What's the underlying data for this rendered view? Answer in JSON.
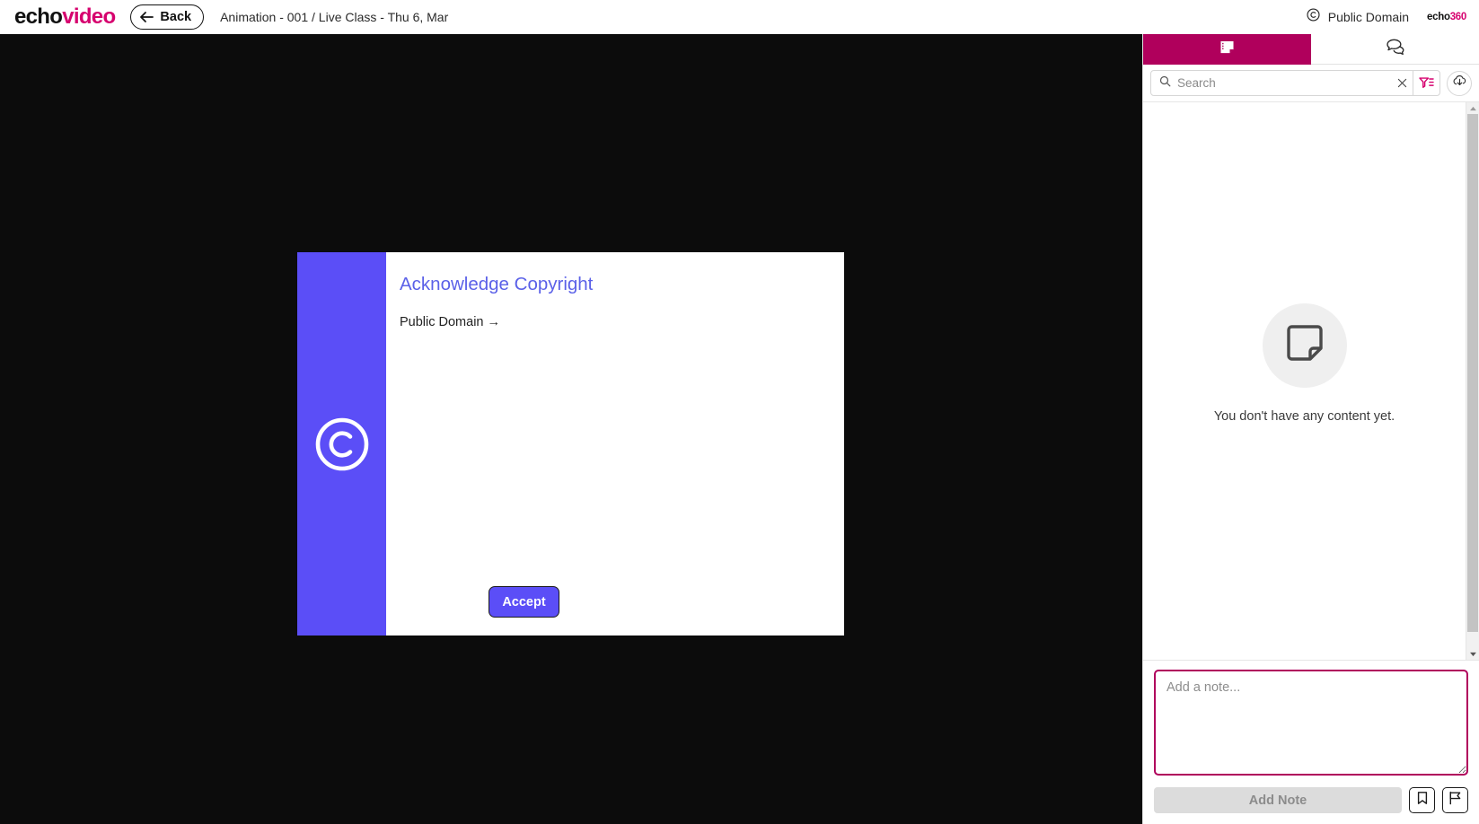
{
  "topbar": {
    "logo_echo": "echo",
    "logo_video": "video",
    "back_label": "Back",
    "breadcrumb": "Animation - 001 / Live Class - Thu 6, Mar",
    "copyright_status": "Public Domain",
    "brand_mark_a": "echo",
    "brand_mark_b": "360",
    "back_icon": "arrow-left-icon",
    "copyright_icon": "copyright-icon"
  },
  "dialog": {
    "title": "Acknowledge Copyright",
    "body": "Public Domain →",
    "accept_label": "Accept",
    "side_icon": "copyright-icon",
    "accent_color": "#5b4ef7",
    "title_color": "#5b61e8"
  },
  "sidebar": {
    "tabs": [
      {
        "name": "notes",
        "icon": "note-icon",
        "active": true
      },
      {
        "name": "discussions",
        "icon": "chat-bubbles-icon",
        "active": false
      }
    ],
    "active_tab_color": "#b0005c",
    "search": {
      "placeholder": "Search",
      "value": "",
      "search_icon": "search-icon",
      "clear_icon": "close-icon",
      "filter_icon": "filter-list-icon",
      "download_icon": "cloud-download-icon"
    },
    "empty_state": {
      "icon": "note-page-icon",
      "message": "You don't have any content yet."
    },
    "composer": {
      "placeholder": "Add a note...",
      "value": "",
      "add_note_label": "Add Note",
      "bookmark_icon": "bookmark-icon",
      "flag_icon": "flag-icon",
      "border_color": "#b0005c"
    },
    "scrollbar": {
      "up_arrow_icon": "caret-up-icon",
      "down_arrow_icon": "caret-down-icon"
    }
  }
}
